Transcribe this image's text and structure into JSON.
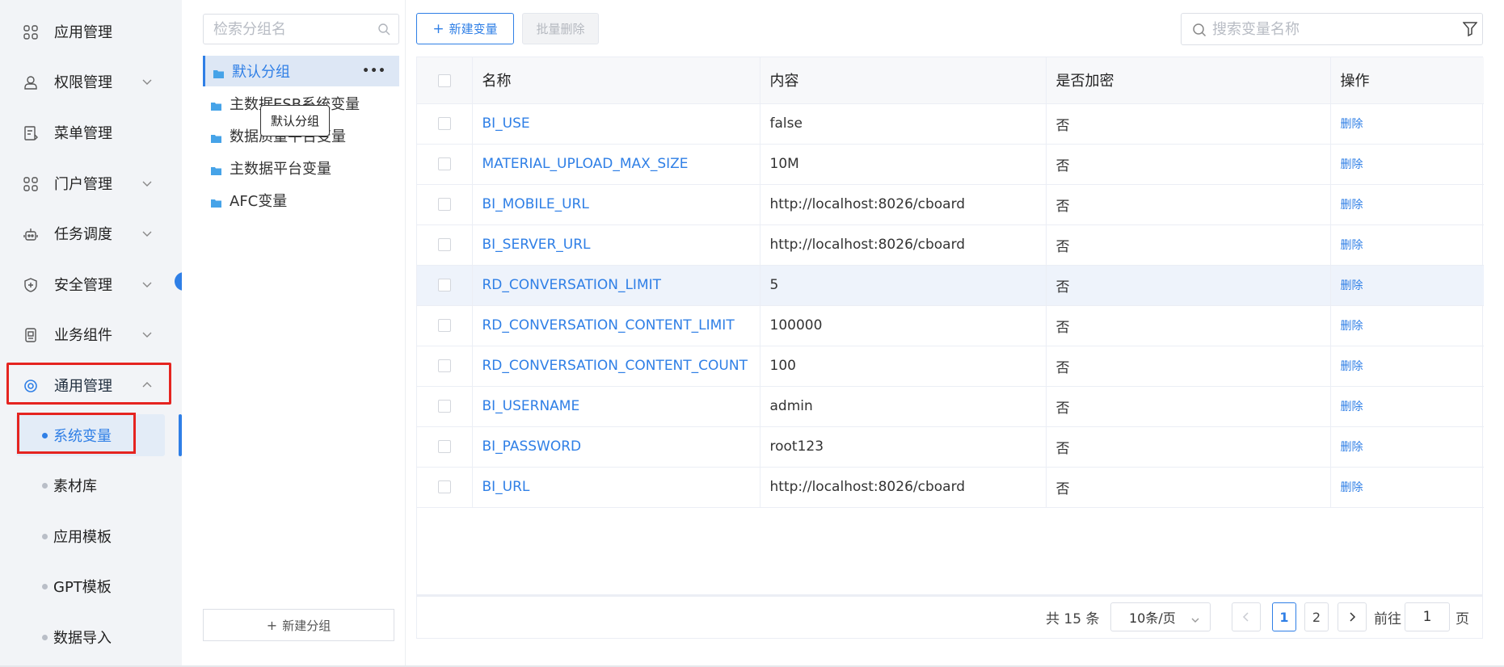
{
  "sidebar": {
    "items": [
      {
        "label": "应用管理",
        "icon": "apps-grid-icon",
        "expandable": false
      },
      {
        "label": "权限管理",
        "icon": "user-permission-icon",
        "expandable": true
      },
      {
        "label": "菜单管理",
        "icon": "menu-doc-icon",
        "expandable": false
      },
      {
        "label": "门户管理",
        "icon": "portal-grid-icon",
        "expandable": true
      },
      {
        "label": "任务调度",
        "icon": "robot-icon",
        "expandable": true
      },
      {
        "label": "安全管理",
        "icon": "shield-icon",
        "expandable": true
      },
      {
        "label": "业务组件",
        "icon": "component-icon",
        "expandable": true
      },
      {
        "label": "通用管理",
        "icon": "settings-circle-icon",
        "expandable": true,
        "expanded": true
      }
    ],
    "sub_items": [
      {
        "label": "系统变量",
        "current": true
      },
      {
        "label": "素材库"
      },
      {
        "label": "应用模板"
      },
      {
        "label": "GPT模板"
      },
      {
        "label": "数据导入"
      }
    ]
  },
  "groups": {
    "search_placeholder": "检索分组名",
    "items": [
      "默认分组",
      "主数据ESB系统变量",
      "数据质量平台变量",
      "主数据平台变量",
      "AFC变量"
    ],
    "tooltip": "默认分组",
    "new_group_label": "新建分组"
  },
  "toolbar": {
    "new_variable_label": "新建变量",
    "batch_delete_label": "批量删除",
    "search_placeholder": "搜索变量名称"
  },
  "table": {
    "columns": [
      "名称",
      "内容",
      "是否加密",
      "操作"
    ],
    "rows": [
      {
        "name": "BI_USE",
        "content": "false",
        "encrypted": "否",
        "action": "删除"
      },
      {
        "name": "MATERIAL_UPLOAD_MAX_SIZE",
        "content": "10M",
        "encrypted": "否",
        "action": "删除"
      },
      {
        "name": "BI_MOBILE_URL",
        "content": "http://localhost:8026/cboard",
        "encrypted": "否",
        "action": "删除"
      },
      {
        "name": "BI_SERVER_URL",
        "content": "http://localhost:8026/cboard",
        "encrypted": "否",
        "action": "删除"
      },
      {
        "name": "RD_CONVERSATION_LIMIT",
        "content": "5",
        "encrypted": "否",
        "action": "删除"
      },
      {
        "name": "RD_CONVERSATION_CONTENT_LIMIT",
        "content": "100000",
        "encrypted": "否",
        "action": "删除"
      },
      {
        "name": "RD_CONVERSATION_CONTENT_COUNT",
        "content": "100",
        "encrypted": "否",
        "action": "删除"
      },
      {
        "name": "BI_USERNAME",
        "content": "admin",
        "encrypted": "否",
        "action": "删除"
      },
      {
        "name": "BI_PASSWORD",
        "content": "root123",
        "encrypted": "否",
        "action": "删除"
      },
      {
        "name": "BI_URL",
        "content": "http://localhost:8026/cboard",
        "encrypted": "否",
        "action": "删除"
      }
    ]
  },
  "pagination": {
    "total_label": "共 15 条",
    "page_size": "10条/页",
    "pages": [
      "1",
      "2"
    ],
    "current_page": "1",
    "goto_prefix": "前往",
    "goto_value": "1",
    "goto_suffix": "页"
  },
  "colors": {
    "accent": "#2f7fe6",
    "highlight_box": "#e52420",
    "sidebar_bg": "#f2f4f7"
  }
}
